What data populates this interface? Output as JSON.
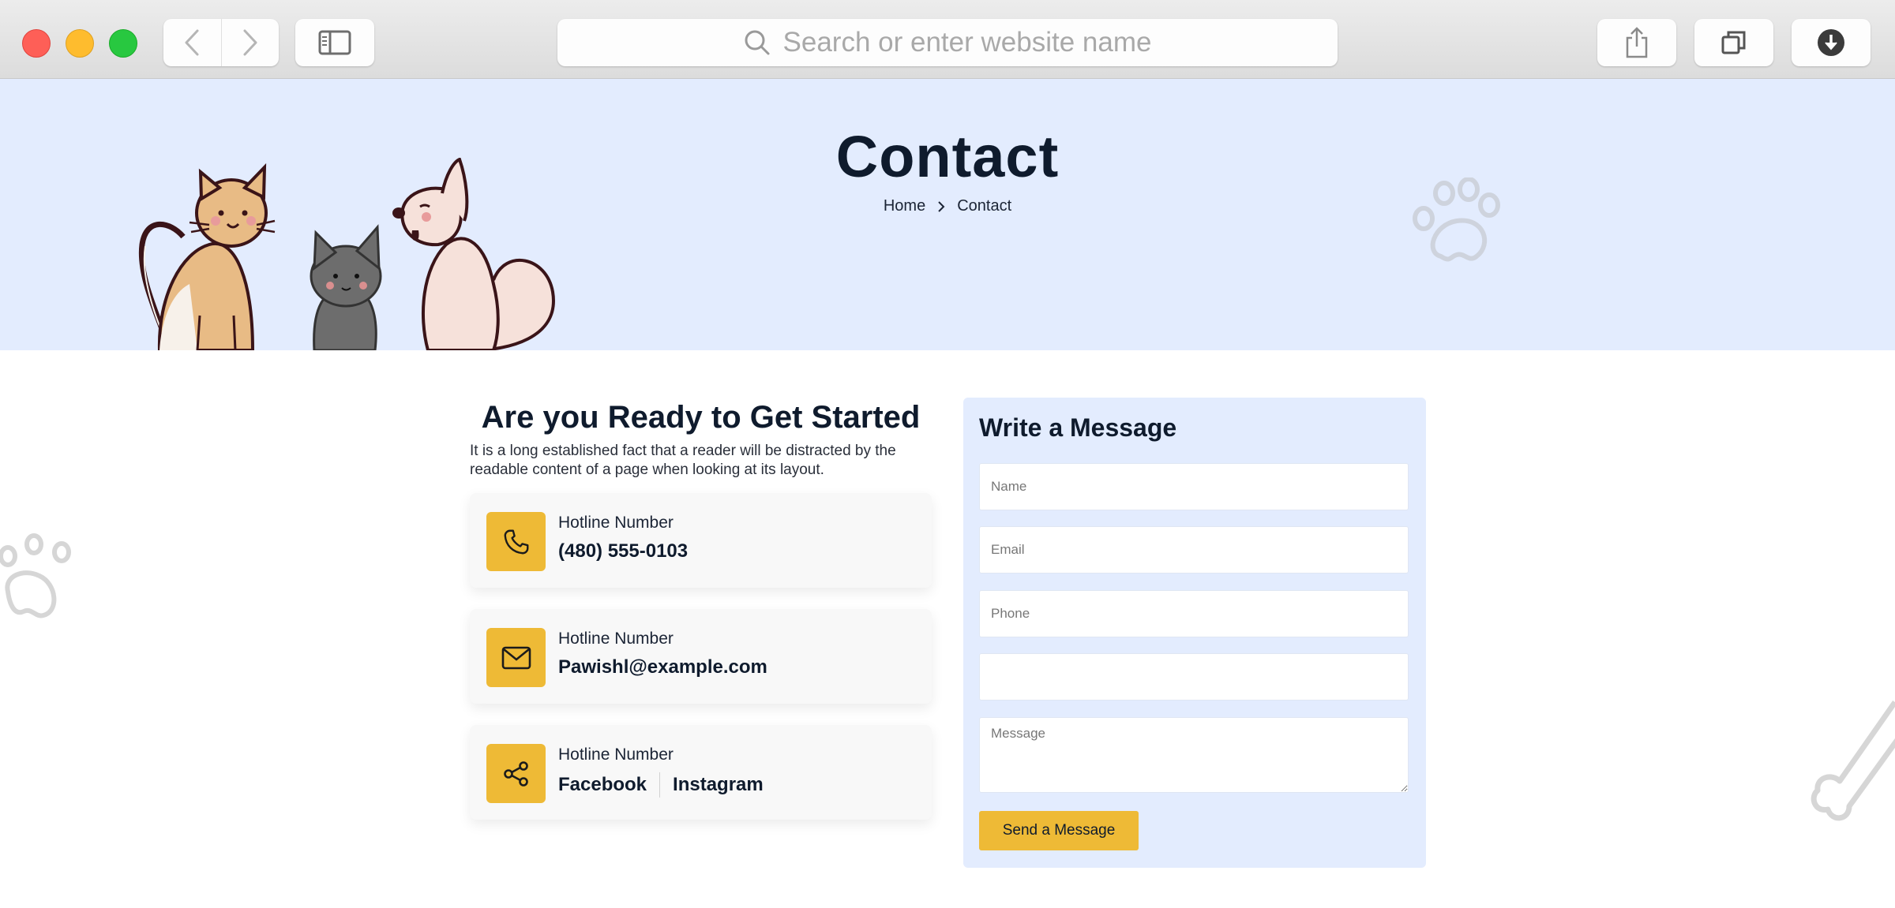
{
  "browser": {
    "address_placeholder": "Search or enter website name"
  },
  "hero": {
    "title": "Contact",
    "breadcrumb": [
      "Home",
      "Contact"
    ]
  },
  "intro": {
    "title": "Are you Ready to Get Started",
    "description": "It is a long established fact that a reader will be distracted by the readable content of a page when looking at its layout."
  },
  "contact_cards": [
    {
      "label": "Hotline Number",
      "value": "(480) 555-0103",
      "icon": "phone-icon"
    },
    {
      "label": "Hotline Number",
      "value": "Pawishl@example.com",
      "icon": "mail-icon"
    },
    {
      "label": "Hotline Number",
      "links": [
        "Facebook",
        "Instagram"
      ],
      "icon": "share-icon"
    }
  ],
  "form": {
    "title": "Write a Message",
    "name_placeholder": "Name",
    "email_placeholder": "Email",
    "phone_placeholder": "Phone",
    "subject_placeholder": "",
    "message_placeholder": "Message",
    "submit_label": "Send a Message"
  },
  "colors": {
    "hero_bg": "#e3ecfe",
    "accent": "#eeba36",
    "heading": "#0f1b2d"
  }
}
